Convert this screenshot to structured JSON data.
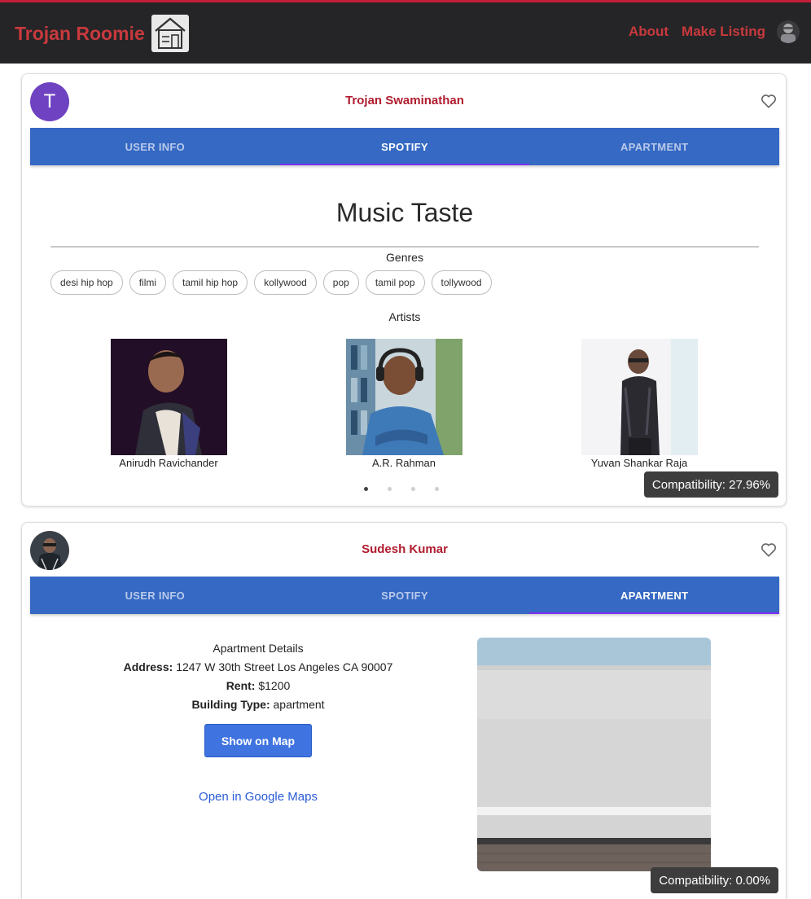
{
  "navbar": {
    "brand": "Trojan Roomie",
    "links": [
      "About",
      "Make Listing"
    ],
    "accent_color": "#c8393d",
    "background": "#252527"
  },
  "cards": [
    {
      "avatar_letter": "T",
      "name": "Trojan Swaminathan",
      "tabs": [
        "USER INFO",
        "SPOTIFY",
        "APARTMENT"
      ],
      "active_tab": "SPOTIFY",
      "spotify": {
        "title": "Music Taste",
        "genres_label": "Genres",
        "genres": [
          "desi hip hop",
          "filmi",
          "tamil hip hop",
          "kollywood",
          "pop",
          "tamil pop",
          "tollywood"
        ],
        "artists_label": "Artists",
        "artists": [
          "Anirudh Ravichander",
          "A.R. Rahman",
          "Yuvan Shankar Raja"
        ],
        "carousel_pages": 4,
        "carousel_active": 1
      },
      "compatibility": "Compatibility: 27.96%"
    },
    {
      "name": "Sudesh Kumar",
      "tabs": [
        "USER INFO",
        "SPOTIFY",
        "APARTMENT"
      ],
      "active_tab": "APARTMENT",
      "apartment": {
        "heading": "Apartment Details",
        "address_label": "Address:",
        "address": "1247 W 30th Street Los Angeles CA 90007",
        "rent_label": "Rent:",
        "rent": "$1200",
        "type_label": "Building Type:",
        "type": "apartment",
        "map_button": "Show on Map",
        "gmaps_link": "Open in Google Maps"
      },
      "compatibility": "Compatibility: 0.00%"
    }
  ]
}
